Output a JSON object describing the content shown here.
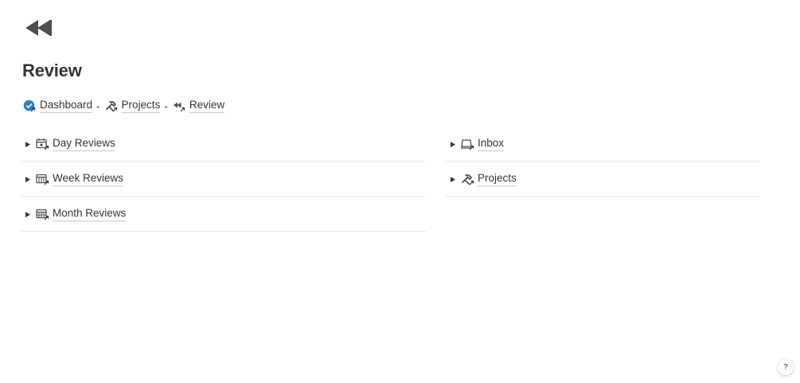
{
  "page": {
    "icon": "rewind-icon",
    "title": "Review"
  },
  "breadcrumb": {
    "items": [
      {
        "label": "Dashboard",
        "icon": "check-circle-icon"
      },
      {
        "label": "Projects",
        "icon": "tools-icon"
      },
      {
        "label": "Review",
        "icon": "rewind-icon"
      }
    ],
    "separator": "-"
  },
  "columns": {
    "left": [
      {
        "label": "Day Reviews",
        "icon": "calendar-day-icon"
      },
      {
        "label": "Week Reviews",
        "icon": "calendar-week-icon"
      },
      {
        "label": "Month Reviews",
        "icon": "calendar-month-icon"
      }
    ],
    "right": [
      {
        "label": "Inbox",
        "icon": "inbox-icon"
      },
      {
        "label": "Projects",
        "icon": "tools-icon"
      }
    ]
  },
  "help": {
    "label": "?"
  },
  "colors": {
    "text": "#37352f",
    "icon": "#4f4f4f",
    "accent_blue": "#2e7ec4",
    "divider": "#e9e9e7"
  }
}
